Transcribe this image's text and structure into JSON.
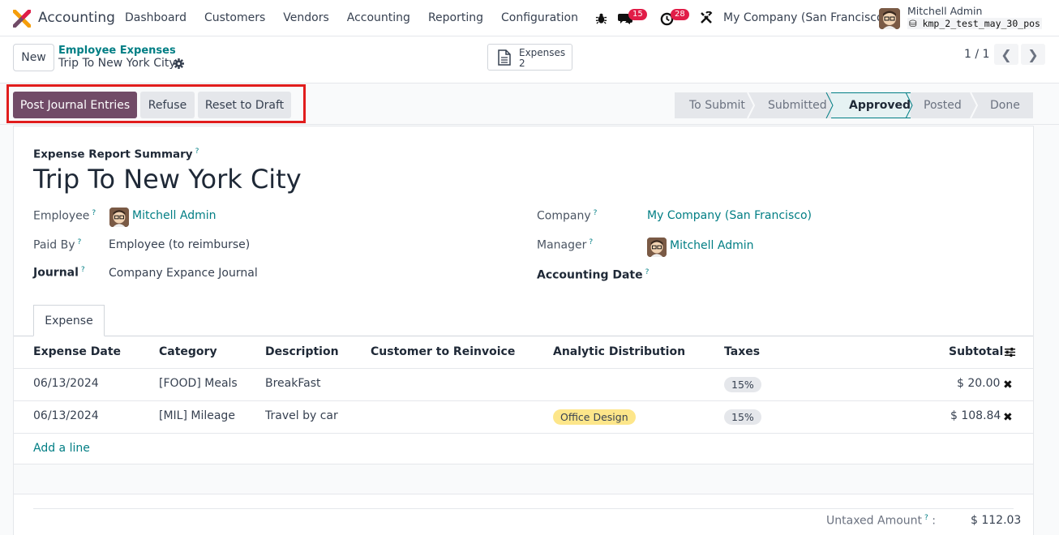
{
  "navbar": {
    "app_name": "Accounting",
    "menu": [
      "Dashboard",
      "Customers",
      "Vendors",
      "Accounting",
      "Reporting",
      "Configuration"
    ],
    "messages_count": "15",
    "activities_count": "28",
    "company": "My Company (San Francisco)",
    "user_name": "Mitchell Admin",
    "db_name": "kmp_2_test_may_30_pos"
  },
  "control": {
    "new_label": "New",
    "breadcrumb_parent": "Employee Expenses",
    "breadcrumb_current": "Trip To New York City",
    "smart_button": {
      "title": "Expenses",
      "value": "2"
    },
    "pager": "1 / 1"
  },
  "actions": {
    "post": "Post Journal Entries",
    "refuse": "Refuse",
    "reset": "Reset to Draft"
  },
  "stages": {
    "to_submit": "To Submit",
    "submitted": "Submitted",
    "approved": "Approved",
    "posted": "Posted",
    "done": "Done"
  },
  "form": {
    "summary_label": "Expense Report Summary",
    "title": "Trip To New York City",
    "employee_label": "Employee",
    "employee_value": "Mitchell Admin",
    "paid_by_label": "Paid By",
    "paid_by_value": "Employee (to reimburse)",
    "journal_label": "Journal",
    "journal_value": "Company Expance Journal",
    "company_label": "Company",
    "company_value": "My Company (San Francisco)",
    "manager_label": "Manager",
    "manager_value": "Mitchell Admin",
    "accounting_date_label": "Accounting Date",
    "help_mark": "?"
  },
  "tab": {
    "label": "Expense"
  },
  "table": {
    "headers": {
      "date": "Expense Date",
      "category": "Category",
      "description": "Description",
      "customer": "Customer to Reinvoice",
      "analytic": "Analytic Distribution",
      "taxes": "Taxes",
      "subtotal": "Subtotal"
    },
    "rows": [
      {
        "date": "06/13/2024",
        "category": "[FOOD] Meals",
        "description": "BreakFast",
        "analytic": "",
        "tax": "15%",
        "subtotal": "$ 20.00"
      },
      {
        "date": "06/13/2024",
        "category": "[MIL] Mileage",
        "description": "Travel by car",
        "analytic": "Office Design",
        "tax": "15%",
        "subtotal": "$ 108.84"
      }
    ],
    "add_line": "Add a line"
  },
  "totals": {
    "untaxed_label": "Untaxed Amount",
    "untaxed_value": "$ 112.03"
  }
}
